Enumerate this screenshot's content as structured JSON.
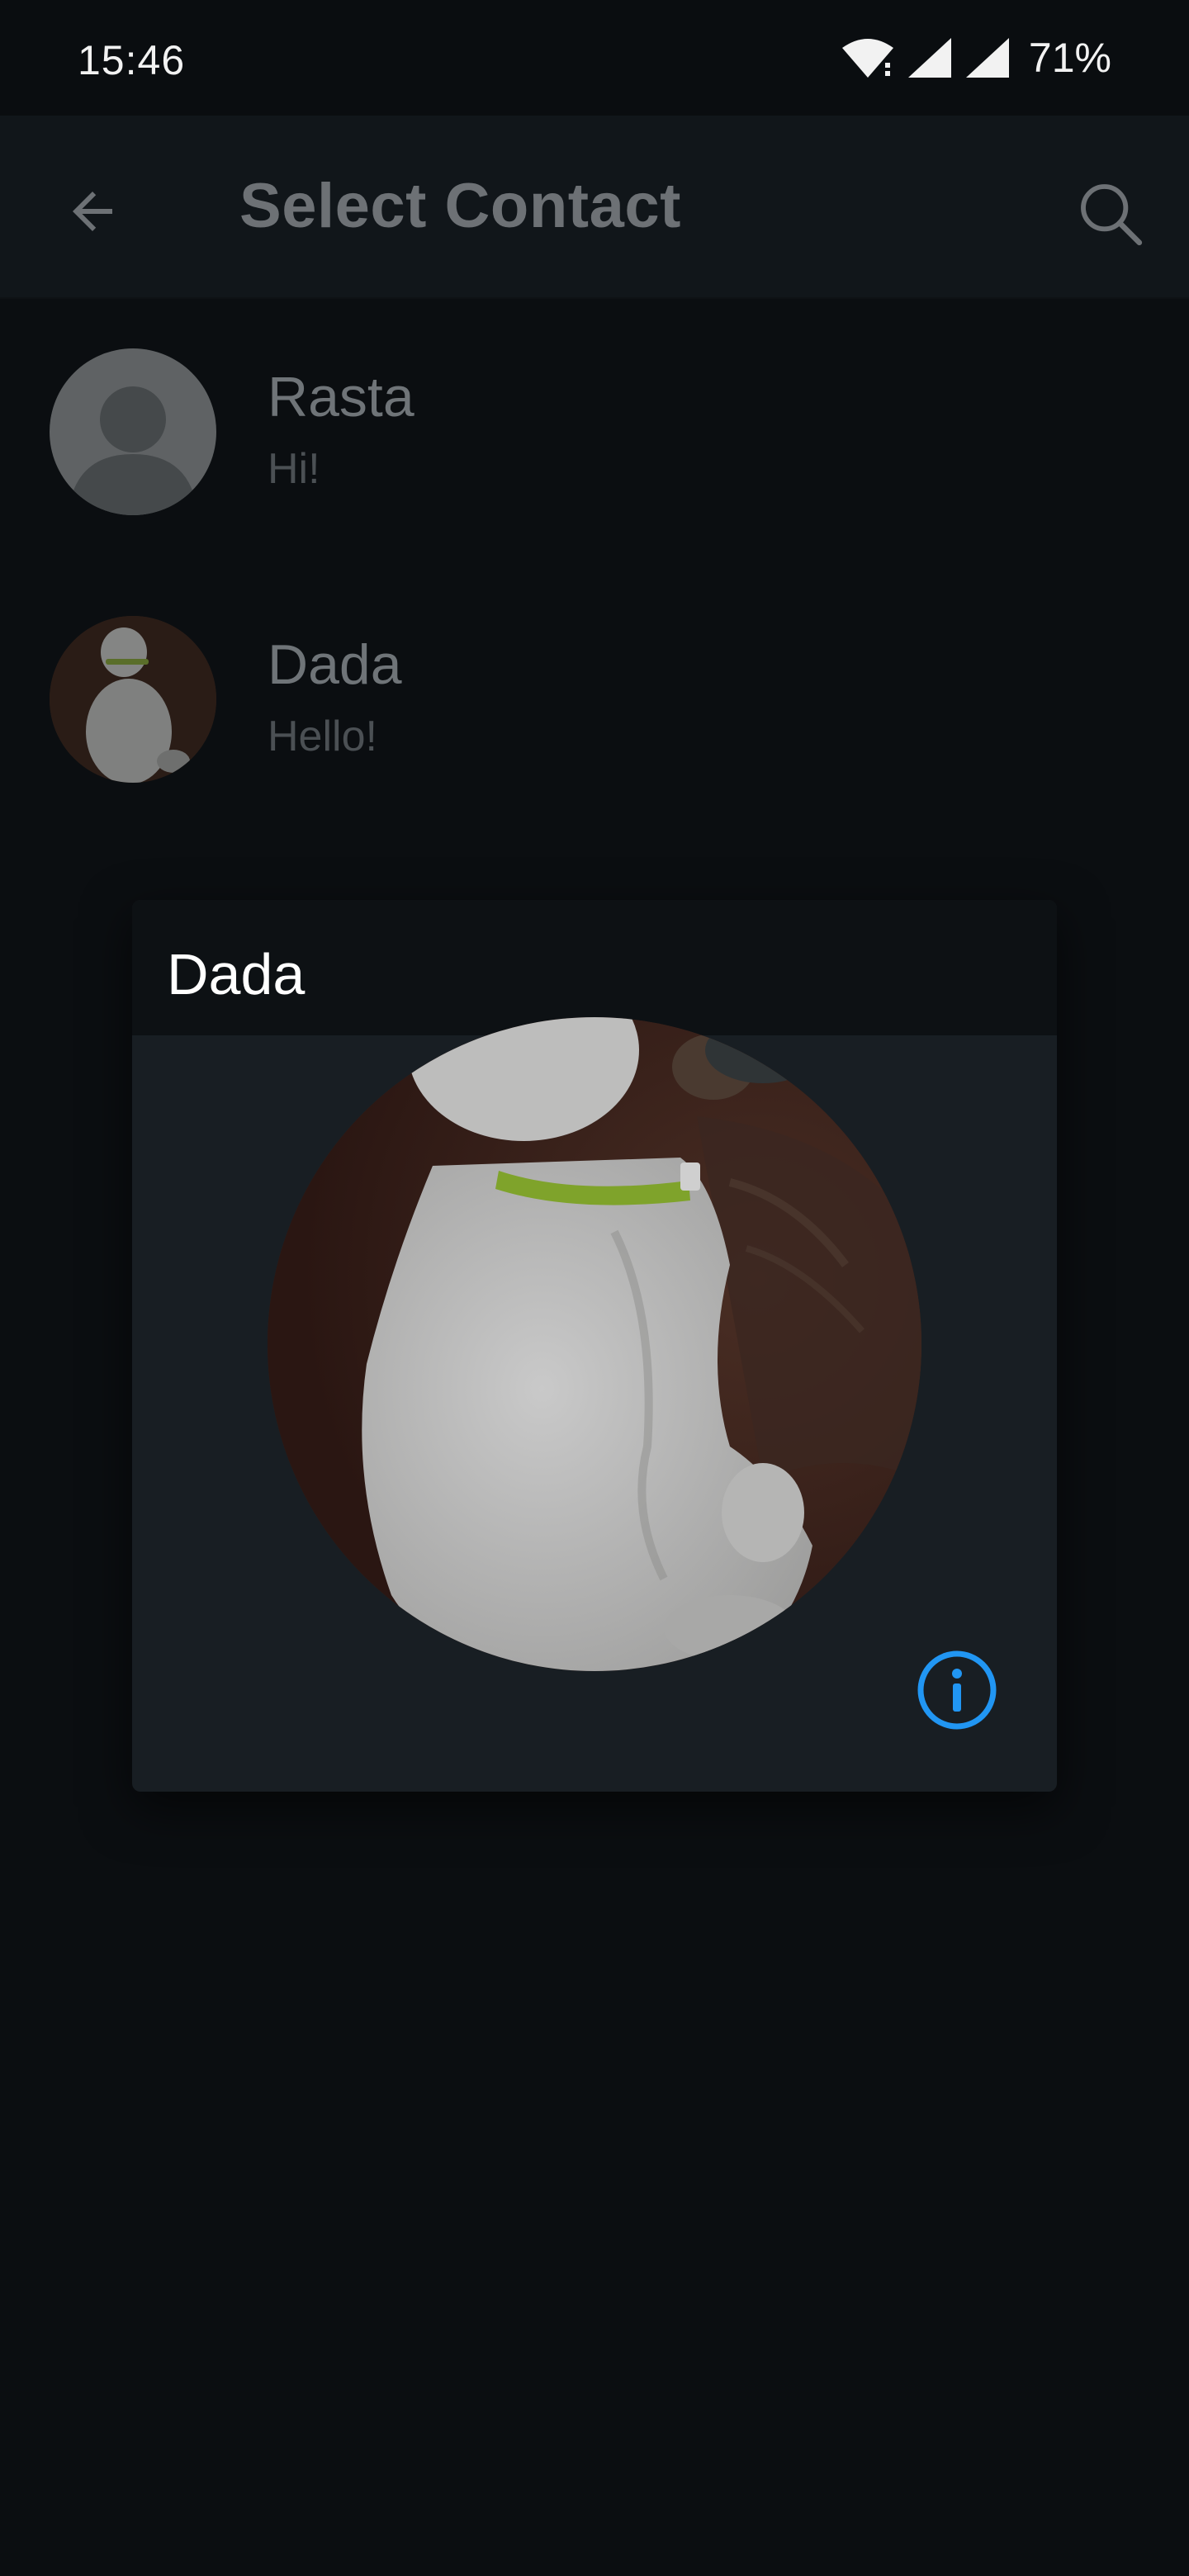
{
  "status_bar": {
    "time": "15:46",
    "battery": "71%",
    "icons": [
      "wifi-icon",
      "signal-icon",
      "signal-icon",
      "battery-percent"
    ]
  },
  "app_bar": {
    "title": "Select Contact",
    "back_icon": "arrow-back-icon",
    "search_icon": "search-icon"
  },
  "contacts": [
    {
      "name": "Rasta",
      "message": "Hi!",
      "avatar": "default-person-icon"
    },
    {
      "name": "Dada",
      "message": "Hello!",
      "avatar": "cat-photo"
    }
  ],
  "dialog": {
    "title": "Dada",
    "photo": "cat-photo",
    "info_icon": "info-icon"
  },
  "colors": {
    "background": "#0b0e11",
    "app_bar": "#11161a",
    "dialog": "#181e23",
    "accent": "#2196f3"
  }
}
